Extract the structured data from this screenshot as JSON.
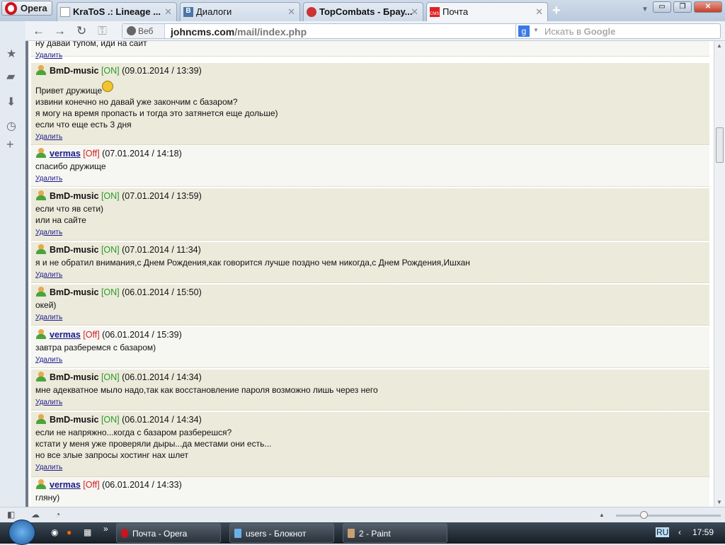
{
  "browser": {
    "menu_label": "Opera",
    "tabs": [
      {
        "title": "KraToS .: Lineage ...",
        "active": false
      },
      {
        "title": "Диалоги",
        "active": false
      },
      {
        "title": "TopCombats - Брау...",
        "active": false
      },
      {
        "title": "Почта",
        "active": true
      }
    ],
    "url_prefix": "Веб",
    "url_domain": "johncms.com",
    "url_path": "/mail/index.php",
    "search_placeholder_pre": "Искать в ",
    "search_placeholder_brand": "Google"
  },
  "page": {
    "partial_top_text": "ну давай тупом, иди на сайт",
    "delete_label": "Удалить",
    "messages": [
      {
        "user": "BmD-music",
        "status": "[ON]",
        "online": true,
        "date": "(09.01.2014 / 13:39)",
        "lines": [
          "Привет дружище",
          "извини конечно но давай уже закончим с базаром?",
          "я могу на время пропасть и тогда это затянется еще дольше)",
          "если что еще есть 3 дня"
        ],
        "smile_after_first": true
      },
      {
        "user": "vermas",
        "status": "[Off]",
        "online": false,
        "date": "(07.01.2014 / 14:18)",
        "lines": [
          "спасибо дружище"
        ]
      },
      {
        "user": "BmD-music",
        "status": "[ON]",
        "online": true,
        "date": "(07.01.2014 / 13:59)",
        "lines": [
          "если что яв сети)",
          "или на сайте"
        ]
      },
      {
        "user": "BmD-music",
        "status": "[ON]",
        "online": true,
        "date": "(07.01.2014 / 11:34)",
        "lines": [
          "я и не обратил внимания,с Днем Рождения,как говорится лучше поздно чем никогда,с Днем Рождения,Ишхан"
        ]
      },
      {
        "user": "BmD-music",
        "status": "[ON]",
        "online": true,
        "date": "(06.01.2014 / 15:50)",
        "lines": [
          "окей)"
        ]
      },
      {
        "user": "vermas",
        "status": "[Off]",
        "online": false,
        "date": "(06.01.2014 / 15:39)",
        "lines": [
          "завтра разберемся с базаром)"
        ]
      },
      {
        "user": "BmD-music",
        "status": "[ON]",
        "online": true,
        "date": "(06.01.2014 / 14:34)",
        "lines": [
          "мне адекватное мыло надо,так как восстановление пароля возможно лишь через него"
        ]
      },
      {
        "user": "BmD-music",
        "status": "[ON]",
        "online": true,
        "date": "(06.01.2014 / 14:34)",
        "lines": [
          "если не напряжно...когда с базаром разберешся?",
          "кстати у меня уже проверяли дыры...да местами они есть...",
          "но все злые запросы хостинг нах шлет"
        ]
      },
      {
        "user": "vermas",
        "status": "[Off]",
        "online": false,
        "date": "(06.01.2014 / 14:33)",
        "lines": [
          "гляну)"
        ]
      }
    ]
  },
  "taskbar": {
    "items": [
      "Почта - Opera",
      "users - Блокнот",
      "2 - Paint"
    ],
    "lang": "RU",
    "time": "17:59"
  }
}
